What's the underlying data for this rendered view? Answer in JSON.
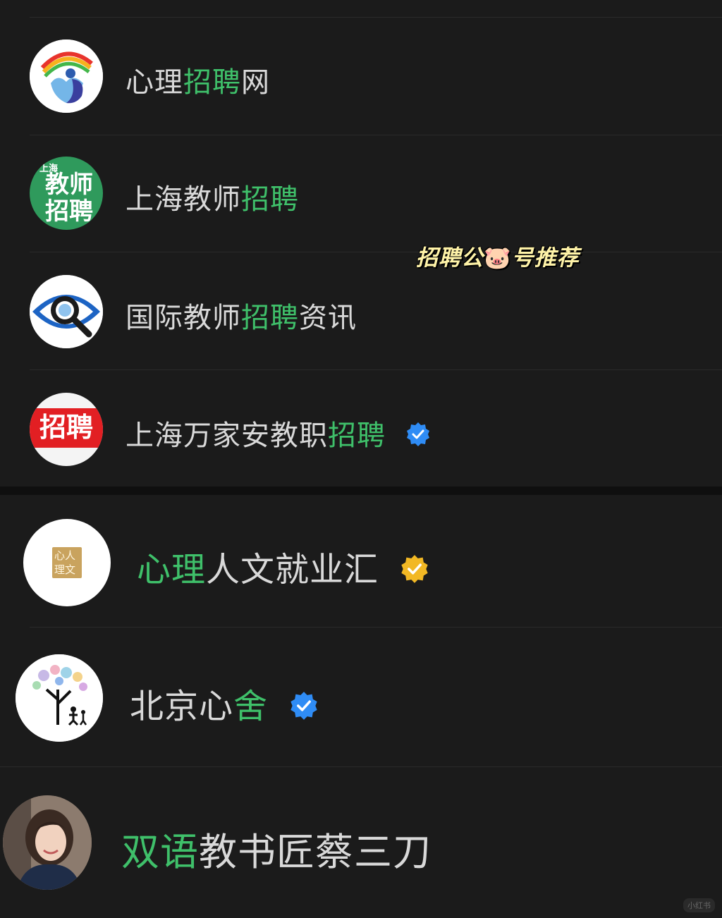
{
  "overlay": {
    "text_before": "招聘公",
    "emoji": "🐷",
    "text_after": "号推荐"
  },
  "accounts": [
    {
      "name_before": "心理",
      "name_highlight": "招聘",
      "name_after": "网",
      "verified": false,
      "avatar_icon": "psychology-heart-rainbow-logo"
    },
    {
      "name_before": "上海教师",
      "name_highlight": "招聘",
      "name_after": "",
      "verified": false,
      "avatar_icon": "green-teacher-recruit-logo",
      "avatar_text_small": "上海",
      "avatar_text_line1": "教师",
      "avatar_text_line2": "招聘"
    },
    {
      "name_before": "国际教师",
      "name_highlight": "招聘",
      "name_after": "资讯",
      "verified": false,
      "avatar_icon": "eye-magnifier-logo"
    },
    {
      "name_before": "上海万家安教职",
      "name_highlight": "招聘",
      "name_after": "",
      "verified": true,
      "verify_color": "#2f8cf5",
      "avatar_icon": "red-recruit-logo",
      "avatar_text": "招聘"
    },
    {
      "name_before": "",
      "name_highlight": "心理",
      "name_after": "人文就业汇",
      "verified": true,
      "verify_color": "#f2b824",
      "avatar_icon": "psych-humanities-seal-logo",
      "avatar_text_line1": "心人",
      "avatar_text_line2": "理文"
    },
    {
      "name_before": "北京心",
      "name_highlight": "舍",
      "name_after": "",
      "verified": true,
      "verify_color": "#2f8cf5",
      "avatar_icon": "butterfly-tree-family-logo"
    },
    {
      "name_before": "",
      "name_highlight": "双语",
      "name_after": "教书匠蔡三刀",
      "verified": false,
      "avatar_icon": "woman-portrait-avatar"
    }
  ],
  "colors": {
    "background": "#1b1b1b",
    "highlight": "#3fc06a",
    "text": "#d9d9d9",
    "verify_blue": "#2f8cf5",
    "verify_gold": "#f2b824",
    "overlay_text": "#fff3a8"
  },
  "watermark": "小红书"
}
